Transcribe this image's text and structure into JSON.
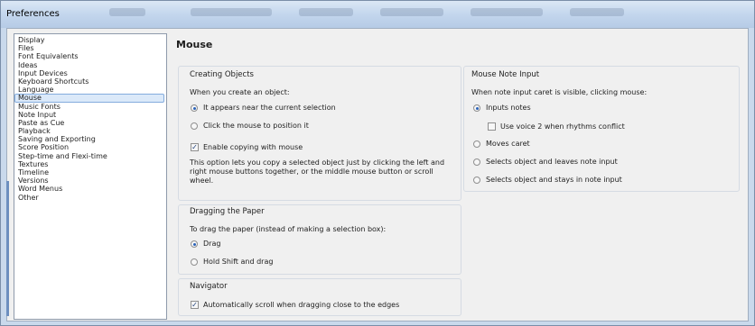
{
  "window": {
    "title": "Preferences"
  },
  "sidebar": {
    "items": [
      "Display",
      "Files",
      "Font Equivalents",
      "Ideas",
      "Input Devices",
      "Keyboard Shortcuts",
      "Language",
      "Mouse",
      "Music Fonts",
      "Note Input",
      "Paste as Cue",
      "Playback",
      "Saving and Exporting",
      "Score Position",
      "Step-time and Flexi-time",
      "Textures",
      "Timeline",
      "Versions",
      "Word Menus",
      "Other"
    ],
    "selected": "Mouse"
  },
  "page": {
    "title": "Mouse"
  },
  "creating_objects": {
    "title": "Creating Objects",
    "prompt": "When you create an object:",
    "option_near": "It appears near the current selection",
    "option_click": "Click the mouse to position it",
    "copy_label": "Enable copying with mouse",
    "description": "This option lets you copy a selected object just by clicking the left and right mouse buttons together, or the middle mouse button or scroll wheel."
  },
  "dragging_paper": {
    "title": "Dragging the Paper",
    "prompt": "To drag the paper (instead of making a selection box):",
    "option_drag": "Drag",
    "option_hold": "Hold Shift and drag"
  },
  "navigator": {
    "title": "Navigator",
    "autoscroll_label": "Automatically scroll when dragging close to the edges"
  },
  "mouse_note_input": {
    "title": "Mouse Note Input",
    "prompt": "When note input caret is visible, clicking mouse:",
    "option_inputs": "Inputs notes",
    "voice2_label": "Use voice 2 when rhythms conflict",
    "option_moves": "Moves caret",
    "option_selects_leaves": "Selects object and leaves note input",
    "option_selects_stays": "Selects object and stays in note input"
  },
  "state": {
    "create_option": "near",
    "copy_enabled": true,
    "drag_option": "drag",
    "autoscroll_enabled": true,
    "note_input_option": "inputs",
    "voice2_enabled": false
  }
}
